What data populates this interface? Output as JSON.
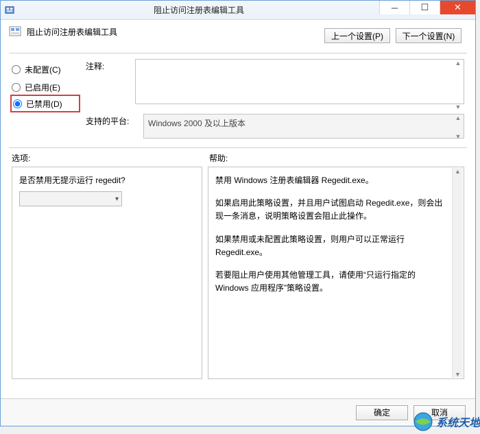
{
  "window": {
    "title": "阻止访问注册表编辑工具"
  },
  "header": {
    "policy_name": "阻止访问注册表编辑工具",
    "prev_button": "上一个设置(P)",
    "next_button": "下一个设置(N)"
  },
  "radios": {
    "not_configured": "未配置(C)",
    "enabled": "已启用(E)",
    "disabled": "已禁用(D)",
    "selected": "disabled"
  },
  "labels": {
    "comment": "注释:",
    "supported_on": "支持的平台:",
    "options": "选项:",
    "help": "帮助:"
  },
  "comment_value": "",
  "supported_on_value": "Windows 2000 及以上版本",
  "options": {
    "question": "是否禁用无提示运行 regedit?",
    "dropdown_value": ""
  },
  "help": {
    "p1": "禁用 Windows 注册表编辑器 Regedit.exe。",
    "p2": "如果启用此策略设置，并且用户试图启动 Regedit.exe，则会出现一条消息，说明策略设置会阻止此操作。",
    "p3": "如果禁用或未配置此策略设置，则用户可以正常运行 Regedit.exe。",
    "p4": "若要阻止用户使用其他管理工具，请使用“只运行指定的 Windows 应用程序”策略设置。"
  },
  "footer": {
    "ok": "确定",
    "cancel": "取消"
  },
  "watermark": "系统天地"
}
